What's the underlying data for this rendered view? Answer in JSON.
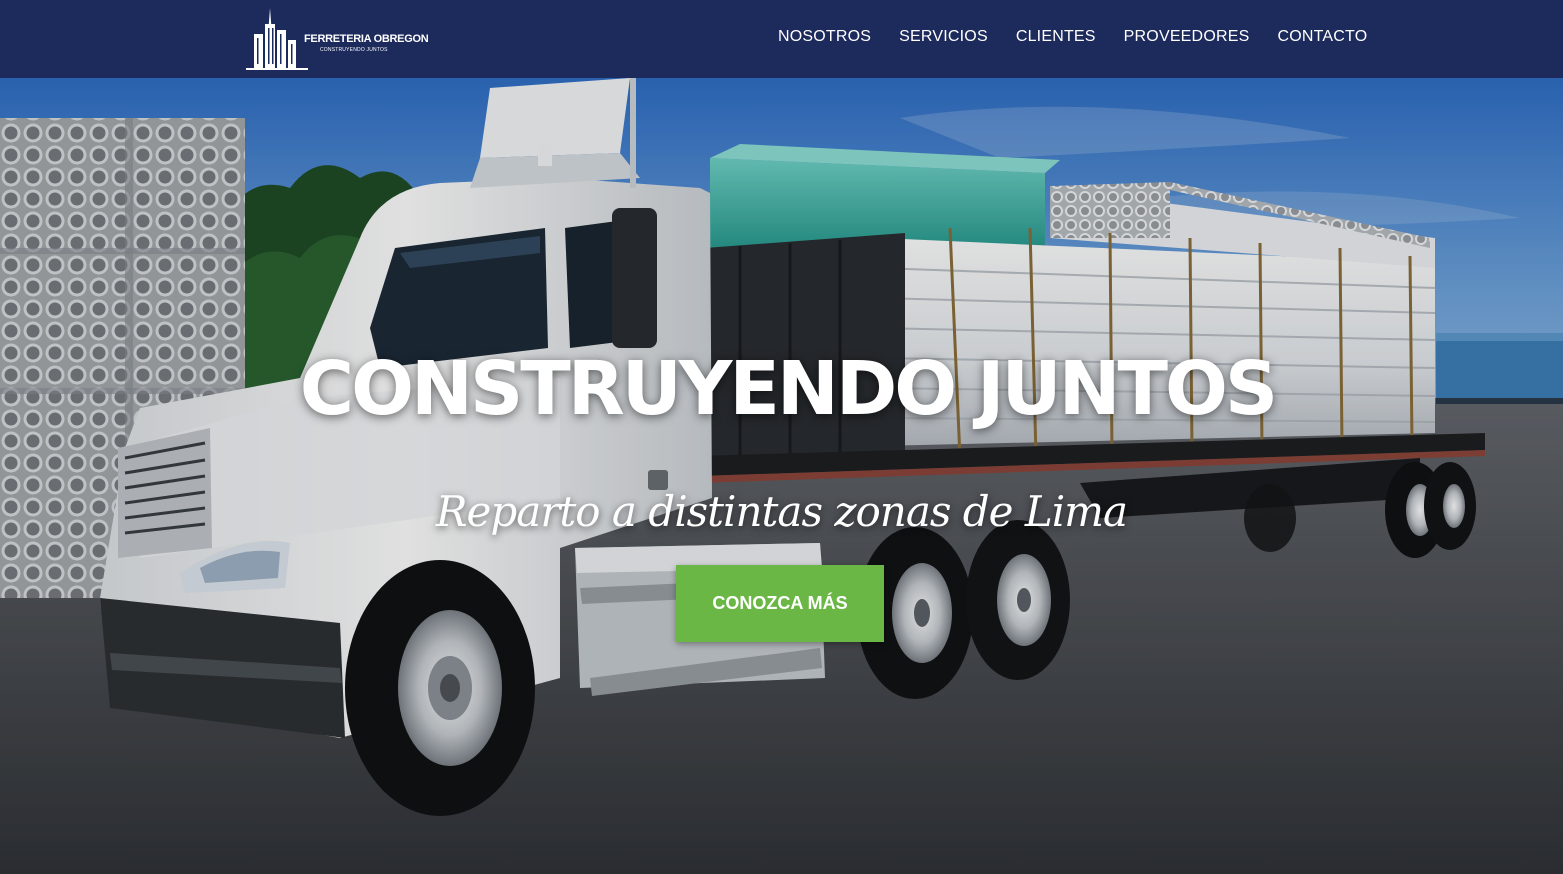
{
  "header": {
    "logo": {
      "name": "FERRETERIA OBREGON",
      "tagline": "CONSTRUYENDO JUNTOS"
    },
    "nav": [
      {
        "label": "NOSOTROS"
      },
      {
        "label": "SERVICIOS"
      },
      {
        "label": "CLIENTES"
      },
      {
        "label": "PROVEEDORES"
      },
      {
        "label": "CONTACTO"
      }
    ]
  },
  "hero": {
    "title": "CONSTRUYENDO JUNTOS",
    "subtitle": "Reparto a distintas zonas de Lima",
    "cta_label": "CONOZCA MÁS",
    "image": "flatbed-truck-loaded-with-pvc-pipes"
  },
  "colors": {
    "nav_background": "#1c2a5c",
    "nav_text": "#ffffff",
    "cta_background": "#6ab745",
    "cta_text": "#ffffff"
  }
}
